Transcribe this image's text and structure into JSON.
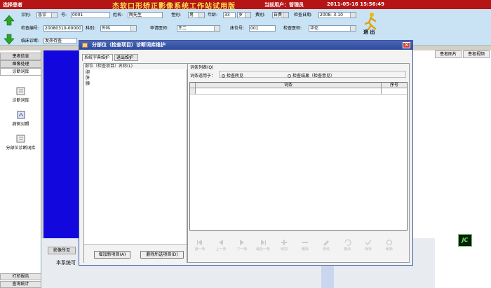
{
  "titlebar": {
    "left_label": "选择患者",
    "app_title": "杰软口形矫正影像系统工作站试用版",
    "current_user": "当前用户：管理员",
    "datetime": "2011-05-16 15:56:49"
  },
  "header": {
    "row1": [
      {
        "label": "诊别:",
        "value": "急诊"
      },
      {
        "label": "号:",
        "value": "0001"
      },
      {
        "label": "姓名:",
        "value": "陶先生"
      },
      {
        "label": "性别:",
        "value": "男"
      },
      {
        "label": "年龄:",
        "value": "33"
      },
      {
        "label": "",
        "value": "岁"
      },
      {
        "label": "费别:",
        "value": "自费"
      },
      {
        "label": "检查日期:",
        "value": "2008- 3-10"
      }
    ],
    "row2": [
      {
        "label": "检查编号:",
        "value": "20080310-000001"
      },
      {
        "label": "科别:",
        "value": "外科"
      },
      {
        "label": "申请医师:",
        "value": "王二"
      },
      {
        "label": "床位号:",
        "value": "001"
      },
      {
        "label": "检查医师:",
        "value": "华佗"
      }
    ],
    "row3": [
      {
        "label": "临床诊断:",
        "value": "发热待查"
      }
    ],
    "exit_label": "退 出"
  },
  "sidebar": {
    "tabs": [
      "患者信息",
      "图像处理",
      "诊断词库"
    ],
    "items": [
      "诊断词库",
      "病例对照",
      "分部位诊断词库"
    ],
    "bottom": [
      "打印报告",
      "查询统计"
    ]
  },
  "right_tabs": [
    "患者图片",
    "患者视频"
  ],
  "background": {
    "button": "影像所见",
    "text": "本系统可",
    "logo": "JC"
  },
  "dialog": {
    "title": "分部位（检查项目）诊断词库维护",
    "tabs": [
      "系统字典维护",
      "退出维护"
    ],
    "left_caption": "部位（检查项目）名称(L)",
    "parts": [
      "胆",
      "肝",
      "胰"
    ],
    "add_button": "增加新项目(A)",
    "delete_button": "删除所选项目(D)",
    "right_caption": "词条列表(Q)",
    "apply_label": "词条适用于：",
    "radio_findings": "检查所见",
    "radio_results": "检查结果（检查意见）",
    "grid_headers": [
      "词条",
      "序号"
    ],
    "toolbar": [
      "第一条",
      "上一条",
      "下一条",
      "最后一条",
      "增加",
      "删除",
      "修改",
      "撤消",
      "保存",
      "刷新"
    ]
  }
}
